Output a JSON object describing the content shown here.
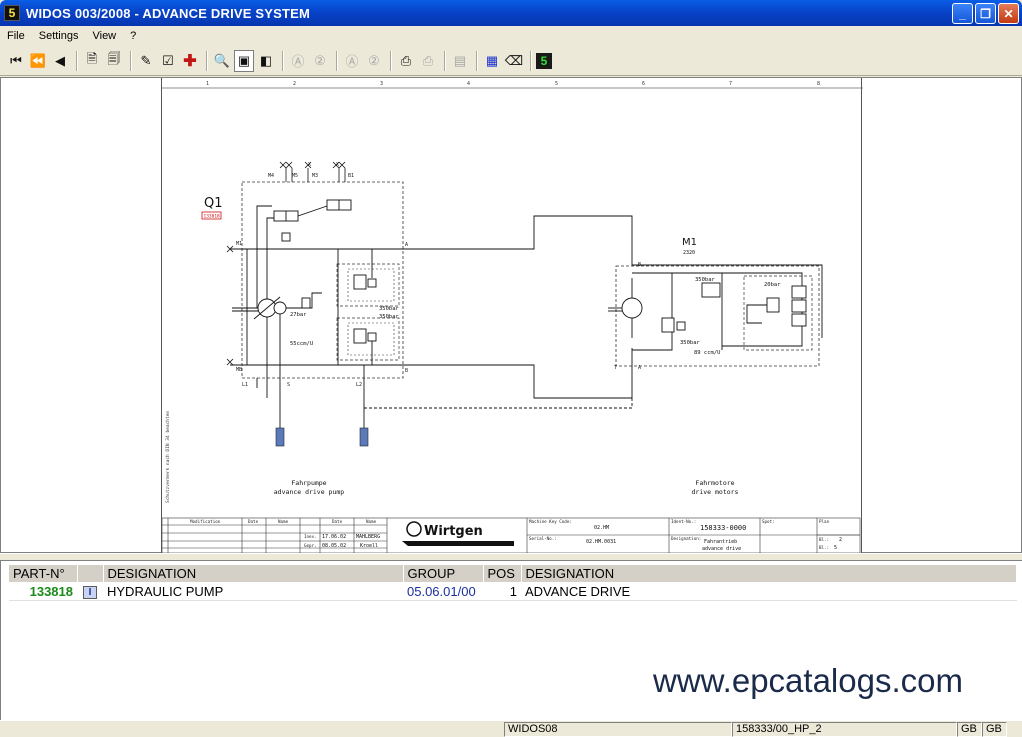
{
  "window": {
    "title": "WIDOS 003/2008 - ADVANCE DRIVE SYSTEM",
    "icon_text": "5"
  },
  "menu": [
    "File",
    "Settings",
    "View",
    "?"
  ],
  "toolbar_icons": [
    "first-page-icon",
    "prev-fast-icon",
    "prev-icon",
    "open-doc-icon",
    "open-doc2-icon",
    "notepad-icon",
    "checklist-icon",
    "red-cross-icon",
    "zoom-icon",
    "page-view-icon",
    "page-fit-icon",
    "a-icon",
    "two-icon",
    "a-icon",
    "two-icon",
    "print-icon",
    "print-preview-icon",
    "export-icon",
    "blue-grid-icon",
    "eraser-icon",
    "widos-logo-icon"
  ],
  "drawing": {
    "column_numbers": [
      "1",
      "2",
      "3",
      "4",
      "5",
      "6",
      "7",
      "8"
    ],
    "q1_label": "Q1",
    "q1_part": "133818",
    "m1_label": "M1",
    "m1_part": "2320",
    "port_labels": [
      "M4",
      "M5",
      "X",
      "M3",
      "X",
      "B1",
      "M1",
      "MB",
      "L1",
      "S",
      "L2",
      "A",
      "B",
      "B",
      "T",
      "A"
    ],
    "pump_pressure": "27bar",
    "pump_disp": "55ccm/U",
    "valve_p1": "350bar",
    "valve_p2": "350bar",
    "motor_p1": "350bar",
    "motor_p2": "350bar",
    "motor_p3": "20bar",
    "motor_disp": "89 ccm/U",
    "left_caption1": "Fahrpumpe",
    "left_caption2": "advance drive pump",
    "right_caption1": "Fahrmotore",
    "right_caption2": "drive motors",
    "side_text": "Schutzvermerk nach DIN 34 beachten",
    "title_block": {
      "mod_header": "Modification",
      "date_header": "Date",
      "name_header": "Name",
      "row_dates": [
        "17.06.02",
        "08.05.02"
      ],
      "row_names": [
        "MAHLBERG",
        "Kroell"
      ],
      "row_labels": [
        "Inev.",
        "Gepr."
      ],
      "machine_key_label": "Machine Key Code:",
      "machine_key": "02.HM",
      "serial_label": "Serial-No.:",
      "serial": "02.HM.0031",
      "ident_label": "Ident-No.:",
      "ident": "158333-0000",
      "designation_label": "Designation:",
      "designation1": "Fahrantrieb",
      "designation2": "advance drive",
      "spot_label": "Spot:",
      "plan_label": "Plan",
      "sheet_label": "Bl.:",
      "sheet_value": "2",
      "sheets_label": "Bl.:",
      "sheets_value": "5",
      "logo_text": "Wirtgen"
    }
  },
  "parts": {
    "headers": [
      "PART-N°",
      "",
      "DESIGNATION",
      "GROUP",
      "POS",
      "DESIGNATION"
    ],
    "rows": [
      {
        "part_no": "133818",
        "info": "I",
        "designation": "HYDRAULIC PUMP",
        "group": "05.06.01/00",
        "pos": "1",
        "designation2": "ADVANCE DRIVE"
      }
    ]
  },
  "watermark": "www.epcatalogs.com",
  "status": {
    "db": "WIDOS08",
    "doc": "158333/00_HP_2",
    "lang1": "GB",
    "lang2": "GB"
  }
}
